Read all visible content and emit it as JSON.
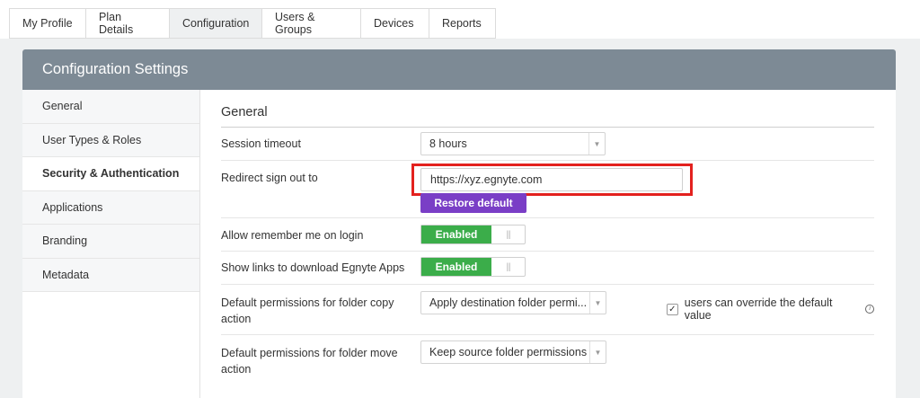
{
  "tabs": [
    {
      "label": "My Profile"
    },
    {
      "label": "Plan Details"
    },
    {
      "label": "Configuration"
    },
    {
      "label": "Users & Groups"
    },
    {
      "label": "Devices"
    },
    {
      "label": "Reports"
    }
  ],
  "active_tab": "Configuration",
  "panel": {
    "title": "Configuration Settings"
  },
  "sidebar": {
    "items": [
      {
        "label": "General"
      },
      {
        "label": "User Types & Roles"
      },
      {
        "label": "Security & Authentication"
      },
      {
        "label": "Applications"
      },
      {
        "label": "Branding"
      },
      {
        "label": "Metadata"
      }
    ],
    "active": "Security & Authentication"
  },
  "main": {
    "section_title": "General",
    "session_timeout": {
      "label": "Session timeout",
      "value": "8 hours"
    },
    "redirect": {
      "label": "Redirect sign out to",
      "value": "https://xyz.egnyte.com",
      "restore_label": "Restore default"
    },
    "remember_me": {
      "label": "Allow remember me on login",
      "toggle_label": "Enabled",
      "grip": "|||"
    },
    "show_links": {
      "label": "Show links to download Egnyte Apps",
      "toggle_label": "Enabled",
      "grip": "|||"
    },
    "copy_perm": {
      "label_line1": "Default permissions for folder copy",
      "label_line2": "action",
      "value": "Apply destination folder permi...",
      "override_label": "users can override the default value",
      "override_checked": true
    },
    "move_perm": {
      "label_line1": "Default permissions for folder move",
      "label_line2": "action",
      "value": "Keep source folder permissions"
    }
  },
  "colors": {
    "header_bg": "#7d8a95",
    "accent_purple": "#7a3ec6",
    "toggle_green": "#3bad4a",
    "highlight_red": "#e3211e"
  }
}
